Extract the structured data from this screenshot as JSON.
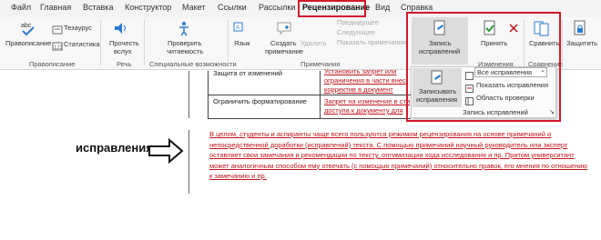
{
  "tabs": [
    "Файл",
    "Главная",
    "Вставка",
    "Конструктор",
    "Макет",
    "Ссылки",
    "Рассылки",
    "Рецензирование",
    "Вид",
    "Справка"
  ],
  "ribbon": {
    "spelling": "Правописание",
    "thesaurus": "Тезаурус",
    "statistics": "Статистика",
    "check_a11y_1": "Проверить",
    "check_a11y_2": "читаемость",
    "read_aloud_1": "Прочесть",
    "read_aloud_2": "вслух",
    "language": "Язык",
    "new_comment_1": "Создать",
    "new_comment_2": "примечание",
    "delete": "Удалить",
    "previous": "Предыдущее",
    "next": "Следующее",
    "show_comments": "Показать примечания",
    "track_changes_1": "Запись",
    "track_changes_2": "исправлений",
    "accept": "Принять",
    "compare": "Сравнить",
    "protect": "Защитить"
  },
  "groups": {
    "proofing": "Правописание",
    "speech": "Речь",
    "accessibility": "Специальные возможности",
    "comments": "Примечания",
    "changes": "Изменения",
    "compare": "Сравнение"
  },
  "popup": {
    "record_1": "Записывать",
    "record_2": "исправления",
    "all_markup": "Все исправления",
    "show_markup": "Показать исправления",
    "reviewing_pane": "Область проверки",
    "group_label": "Запись исправлений"
  },
  "table": {
    "row1_label": "Защита от изменений",
    "row1_text_1": "Установить запрет или",
    "row1_text_2": "ограничения в части внес",
    "row1_text_3": "корректив в документ",
    "row2_label": "Ограничить форматирование",
    "row2_text_1": "Запрет на изменение в сти",
    "row2_text_2": "доступа к документу для"
  },
  "callout": "исправления",
  "paragraph": "В целом, студенты и аспиранты чаще всего пользуются режимом рецензирования на основе примечаний и непосредственной доработки (исправлений) текста. С помощью примечаний научный руководитель или эксперт оставляет свои замечания и рекомендации по тексту, оптимизации хода исследования и пр. Притом университант может аналогичным способом ему отвечать (с помощью примечаний) относительно правок, его мнения по отношению к замечанию и пр.",
  "colors": {
    "highlight": "#d3182b",
    "revision_text": "#c0141b"
  }
}
